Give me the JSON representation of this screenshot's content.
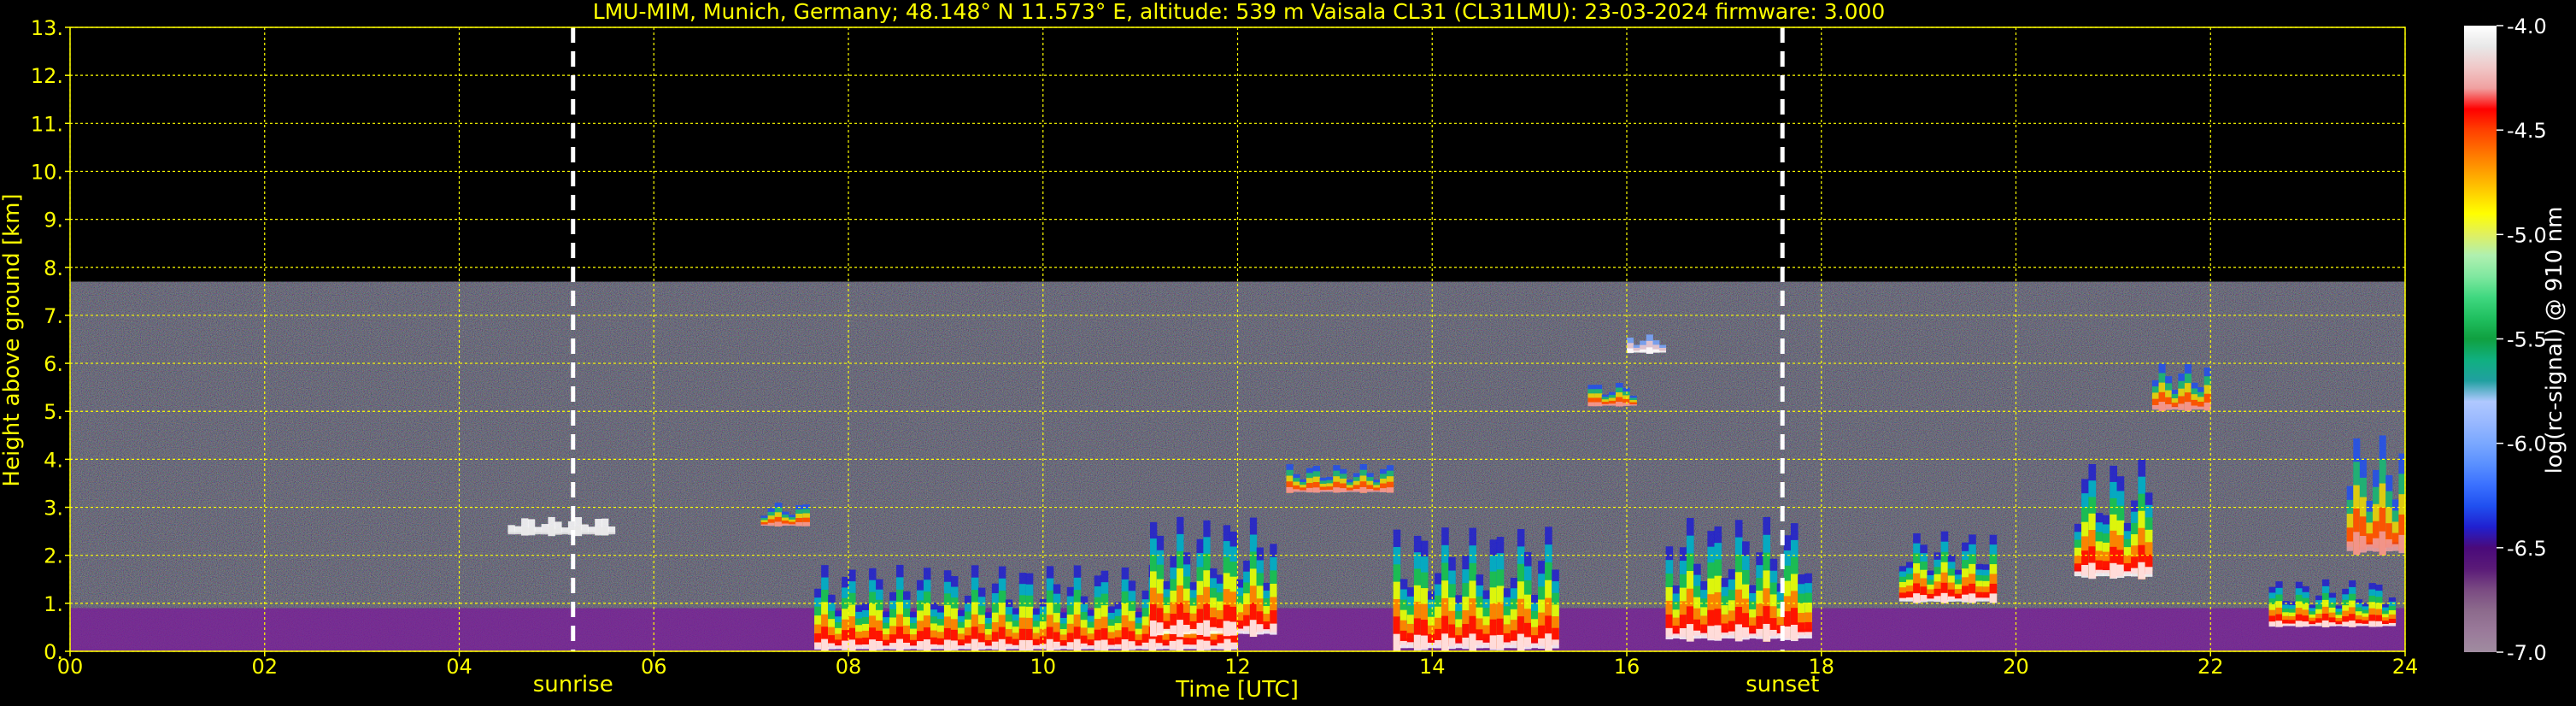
{
  "chart_data": {
    "type": "heatmap",
    "title": "LMU-MIM, Munich, Germany; 48.148° N 11.573° E, altitude: 539 m    Vaisala CL31 (CL31LMU): 23-03-2024    firmware: 3.000",
    "xlabel": "Time [UTC]",
    "ylabel": "Height above ground [km]",
    "xlim": [
      0,
      24
    ],
    "ylim": [
      0,
      13
    ],
    "x_ticks": [
      "00",
      "02",
      "04",
      "06",
      "08",
      "10",
      "12",
      "14",
      "16",
      "18",
      "20",
      "22",
      "24"
    ],
    "y_ticks": [
      "0.",
      "1.",
      "2.",
      "3.",
      "4.",
      "5.",
      "6.",
      "7.",
      "8.",
      "9.",
      "10.",
      "11.",
      "12.",
      "13."
    ],
    "grid": true,
    "markers": [
      {
        "label": "sunrise",
        "x": 5.17
      },
      {
        "label": "sunset",
        "x": 17.6
      }
    ],
    "colorbar": {
      "label": "log(rc-signal) @ 910 nm",
      "range": [
        -7.0,
        -4.0
      ],
      "ticks": [
        "-4.0",
        "-4.5",
        "-5.0",
        "-5.5",
        "-6.0",
        "-6.5",
        "-7.0"
      ],
      "colors": [
        "#a08ca0",
        "#9a7a9a",
        "#8c6a8c",
        "#7a4a82",
        "#5a1a78",
        "#4a0a7a",
        "#2020d0",
        "#2050f0",
        "#3a70ff",
        "#5a90ff",
        "#7aa8ff",
        "#98b8ff",
        "#b0c8ff",
        "#20a0a0",
        "#10b080",
        "#10a040",
        "#20c060",
        "#40d880",
        "#80e8a0",
        "#b0f0b0",
        "#e0f060",
        "#ffff00",
        "#ffd000",
        "#ffa000",
        "#ff7000",
        "#ff4000",
        "#ff0000",
        "#f0a0a0",
        "#f0c8c8",
        "#e8e8e8",
        "#ffffff"
      ]
    },
    "noise_top_km": 7.7,
    "layers": [
      {
        "x": [
          7.65,
          12.0
        ],
        "y": [
          0.0,
          1.8
        ],
        "intensity": "strong"
      },
      {
        "x": [
          11.1,
          12.4
        ],
        "y": [
          0.3,
          2.8
        ],
        "intensity": "strong"
      },
      {
        "x": [
          13.6,
          15.3
        ],
        "y": [
          0.0,
          2.6
        ],
        "intensity": "strong"
      },
      {
        "x": [
          16.4,
          17.9
        ],
        "y": [
          0.2,
          2.8
        ],
        "intensity": "strong"
      },
      {
        "x": [
          18.8,
          19.8
        ],
        "y": [
          1.0,
          2.5
        ],
        "intensity": "strong"
      },
      {
        "x": [
          20.6,
          21.4
        ],
        "y": [
          1.5,
          4.0
        ],
        "intensity": "strong"
      },
      {
        "x": [
          21.4,
          22.0
        ],
        "y": [
          5.0,
          6.0
        ],
        "intensity": "medium"
      },
      {
        "x": [
          15.6,
          16.1
        ],
        "y": [
          5.1,
          5.6
        ],
        "intensity": "medium"
      },
      {
        "x": [
          12.5,
          13.6
        ],
        "y": [
          3.3,
          3.9
        ],
        "intensity": "medium"
      },
      {
        "x": [
          16.0,
          16.4
        ],
        "y": [
          6.2,
          6.6
        ],
        "intensity": "weak"
      },
      {
        "x": [
          4.5,
          5.6
        ],
        "y": [
          2.4,
          2.8
        ],
        "intensity": "white"
      },
      {
        "x": [
          7.1,
          7.6
        ],
        "y": [
          2.6,
          3.1
        ],
        "intensity": "medium"
      },
      {
        "x": [
          23.4,
          24.0
        ],
        "y": [
          2.0,
          4.5
        ],
        "intensity": "medium"
      },
      {
        "x": [
          22.6,
          23.9
        ],
        "y": [
          0.5,
          1.5
        ],
        "intensity": "strong"
      }
    ]
  }
}
